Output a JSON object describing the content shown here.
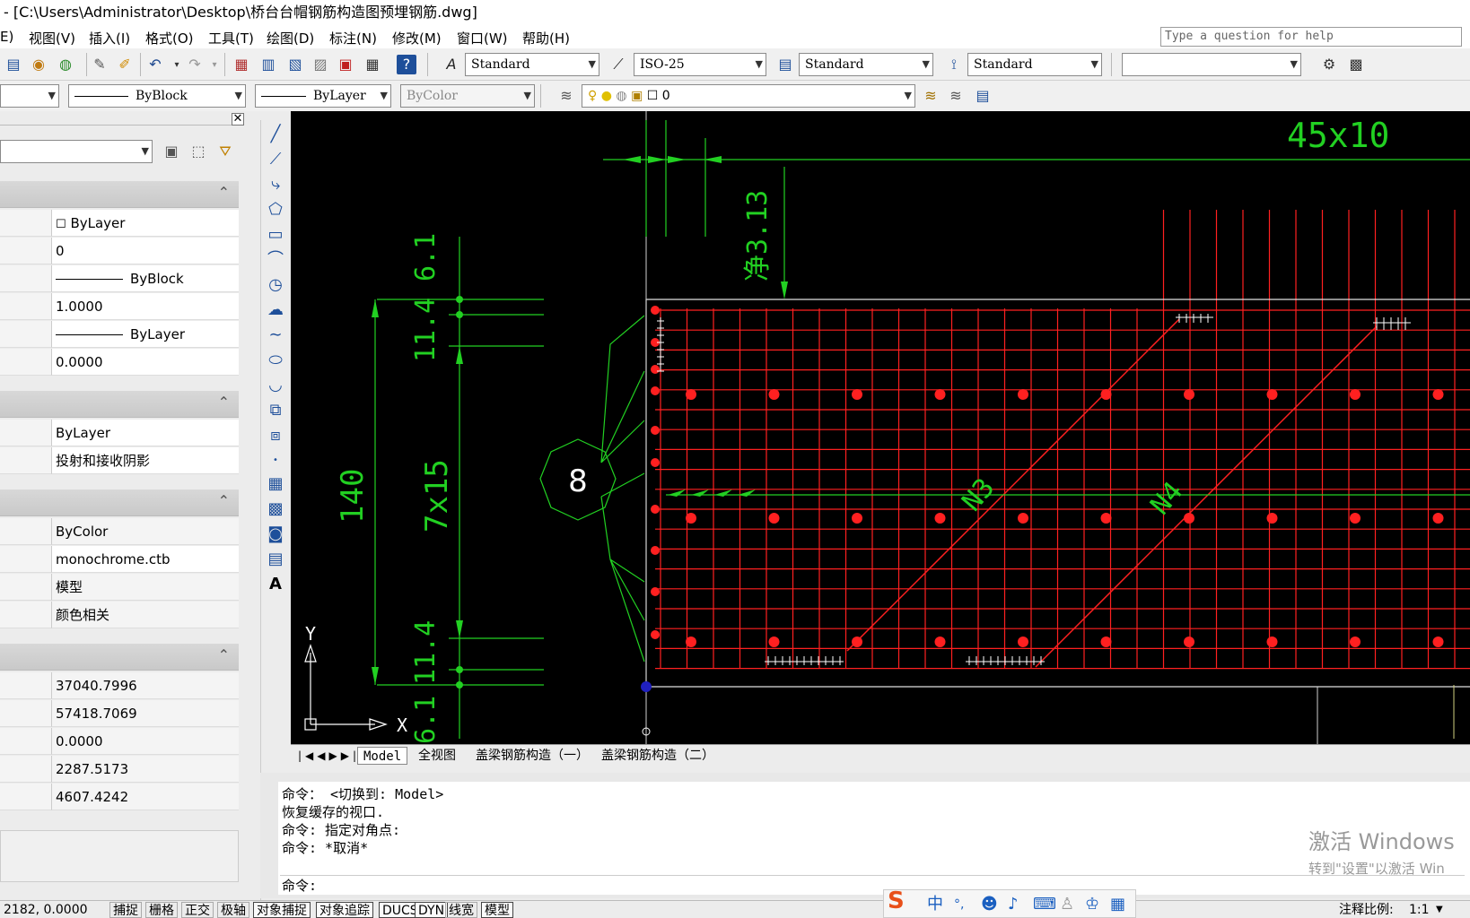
{
  "window": {
    "title": "- [C:\\Users\\Administrator\\Desktop\\桥台台帽钢筋构造图预埋钢筋.dwg]"
  },
  "menu": [
    "E)",
    "视图(V)",
    "插入(I)",
    "格式(O)",
    "工具(T)",
    "绘图(D)",
    "标注(N)",
    "修改(M)",
    "窗口(W)",
    "帮助(H)"
  ],
  "help": {
    "placeholder": "Type a question for help"
  },
  "toolbar": {
    "text_style": "Standard",
    "dim_style": "ISO-25",
    "table_style": "Standard",
    "multileader_style": "Standard",
    "linetype": "ByBlock",
    "lineweight": "ByLayer",
    "plotstyle": "ByColor",
    "layer": "0"
  },
  "properties": {
    "general": [
      "ByLayer",
      "0",
      "ByBlock",
      "1.0000",
      "ByLayer",
      "0.0000"
    ],
    "shadow": [
      "ByLayer",
      "投射和接收阴影"
    ],
    "plot": [
      "ByColor",
      "monochrome.ctb",
      "模型",
      "颜色相关"
    ],
    "view": [
      "37040.7996",
      "57418.7069",
      "0.0000",
      "2287.5173",
      "4607.4242"
    ]
  },
  "drawing": {
    "dims": {
      "top": "45x10",
      "clear": "净3.13",
      "d1": "6.1",
      "d2": "11.4",
      "span": "140",
      "spacing": "7x15",
      "d3": "11.4",
      "d4": "6.1"
    },
    "bubble": "8",
    "labels": {
      "n3": "N3",
      "n4": "N4"
    },
    "ucs": {
      "x": "X",
      "y": "Y"
    },
    "colors": {
      "rebar": "#ff2020",
      "dim": "#22d022",
      "outline": "#e8e8e8",
      "background": "#000000"
    }
  },
  "tabs": [
    "Model",
    "全视图",
    "盖梁钢筋构造（一）",
    "盖梁钢筋构造（二）"
  ],
  "command_history": [
    "命令：  <切换到: Model>",
    "恢复缓存的视口.",
    "命令: 指定对角点:",
    "命令: *取消*"
  ],
  "command_prompt": "命令:",
  "watermark": {
    "line1": "激活 Windows",
    "line2": "转到\"设置\"以激活 Win"
  },
  "status": {
    "coords": "2182, 0.0000",
    "buttons": [
      "捕捉",
      "栅格",
      "正交",
      "极轴",
      "对象捕捉",
      "对象追踪",
      "DUCS",
      "DYN",
      "线宽",
      "模型"
    ],
    "annotation_scale_label": "注释比例:",
    "annotation_scale": "1:1"
  },
  "ime": {
    "mode": "中",
    "punct": "°,"
  }
}
